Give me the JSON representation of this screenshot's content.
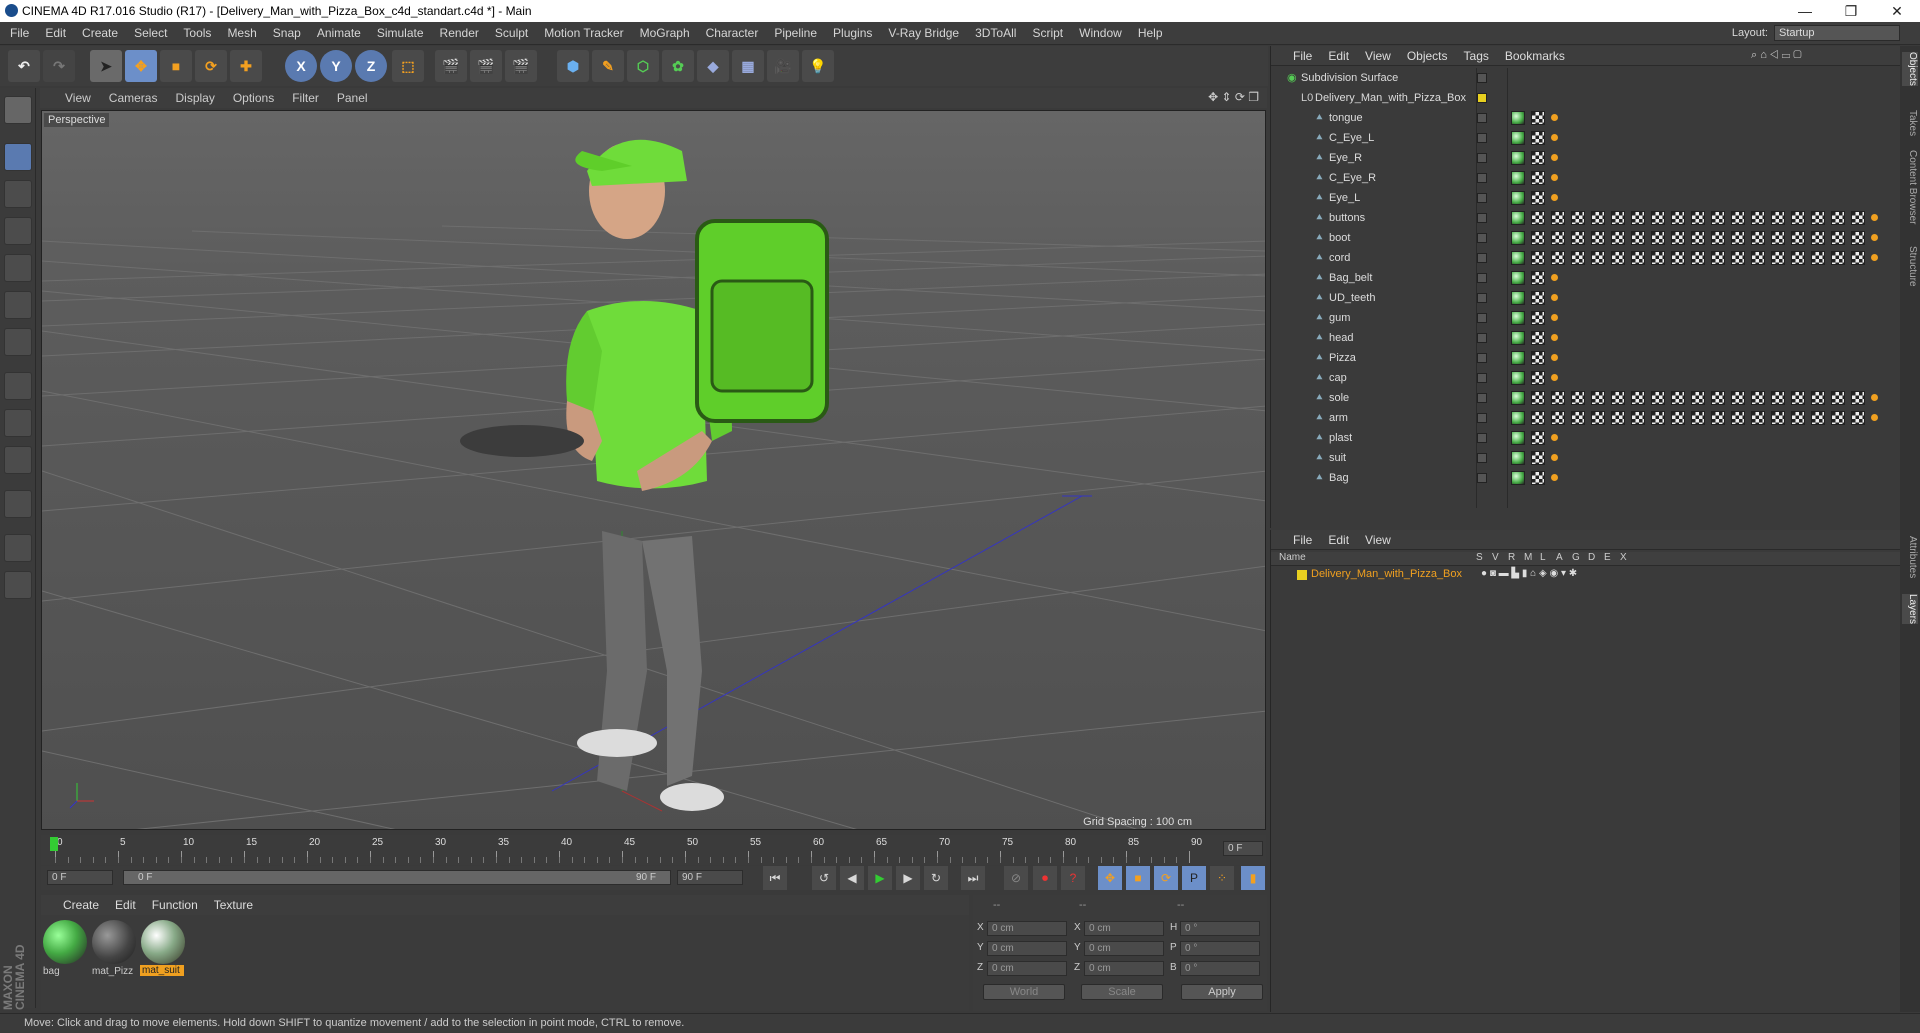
{
  "window": {
    "title": "CINEMA 4D R17.016 Studio (R17) - [Delivery_Man_with_Pizza_Box_c4d_standart.c4d *] - Main",
    "controls": [
      "—",
      "❐",
      "✕"
    ]
  },
  "menubar": {
    "items": [
      "File",
      "Edit",
      "Create",
      "Select",
      "Tools",
      "Mesh",
      "Snap",
      "Animate",
      "Simulate",
      "Render",
      "Sculpt",
      "Motion Tracker",
      "MoGraph",
      "Character",
      "Pipeline",
      "Plugins",
      "V-Ray Bridge",
      "3DToAll",
      "Script",
      "Window",
      "Help"
    ],
    "layout_label": "Layout:",
    "layout_value": "Startup"
  },
  "toolbar": {
    "axis_labels": [
      "X",
      "Y",
      "Z"
    ]
  },
  "viewport": {
    "menu": [
      "View",
      "Cameras",
      "Display",
      "Options",
      "Filter",
      "Panel"
    ],
    "label": "Perspective",
    "grid_spacing": "Grid Spacing : 100 cm"
  },
  "timeline": {
    "ticks": [
      "0",
      "5",
      "10",
      "15",
      "20",
      "25",
      "30",
      "35",
      "40",
      "45",
      "50",
      "55",
      "60",
      "65",
      "70",
      "75",
      "80",
      "85",
      "90"
    ],
    "current_frame": "0 F",
    "start_field": "0 F",
    "range_start": "0 F",
    "range_end": "90 F",
    "end_field": "90 F"
  },
  "materials": {
    "menu": [
      "Create",
      "Edit",
      "Function",
      "Texture"
    ],
    "items": [
      {
        "name": "bag",
        "selected": false
      },
      {
        "name": "mat_Pizz",
        "selected": false
      },
      {
        "name": "mat_suit",
        "selected": true
      }
    ]
  },
  "coordinates": {
    "headers": [
      "--",
      "--",
      "--"
    ],
    "rows": [
      {
        "a": "X",
        "av": "0 cm",
        "b": "X",
        "bv": "0 cm",
        "c": "H",
        "cv": "0 °"
      },
      {
        "a": "Y",
        "av": "0 cm",
        "b": "Y",
        "bv": "0 cm",
        "c": "P",
        "cv": "0 °"
      },
      {
        "a": "Z",
        "av": "0 cm",
        "b": "Z",
        "bv": "0 cm",
        "c": "B",
        "cv": "0 °"
      }
    ],
    "world": "World",
    "scale": "Scale",
    "apply": "Apply"
  },
  "objects": {
    "menu": [
      "File",
      "Edit",
      "View",
      "Objects",
      "Tags",
      "Bookmarks"
    ],
    "root": "Subdivision Surface",
    "group": "Delivery_Man_with_Pizza_Box",
    "children": [
      "tongue",
      "C_Eye_L",
      "Eye_R",
      "C_Eye_R",
      "Eye_L",
      "buttons",
      "boot",
      "cord",
      "Bag_belt",
      "UD_teeth",
      "gum",
      "head",
      "Pizza",
      "cap",
      "sole",
      "arm",
      "plast",
      "suit",
      "Bag"
    ],
    "long_tag_rows": [
      "buttons",
      "boot",
      "cord",
      "sole",
      "arm"
    ]
  },
  "layers": {
    "menu": [
      "File",
      "Edit",
      "View"
    ],
    "name_header": "Name",
    "flag_headers": [
      "S",
      "V",
      "R",
      "M",
      "L",
      "A",
      "G",
      "D",
      "E",
      "X"
    ],
    "item": "Delivery_Man_with_Pizza_Box"
  },
  "side_tabs": [
    "Objects",
    "Takes",
    "Content Browser",
    "Structure",
    "Attributes",
    "Layers"
  ],
  "status": "Move: Click and drag to move elements. Hold down SHIFT to quantize movement / add to the selection in point mode, CTRL to remove.",
  "brand": "MAXON CINEMA 4D",
  "colors": {
    "accent_orange": "#f0a020",
    "shirt_green": "#6fdc3a",
    "layer_yellow": "#e8d020"
  }
}
